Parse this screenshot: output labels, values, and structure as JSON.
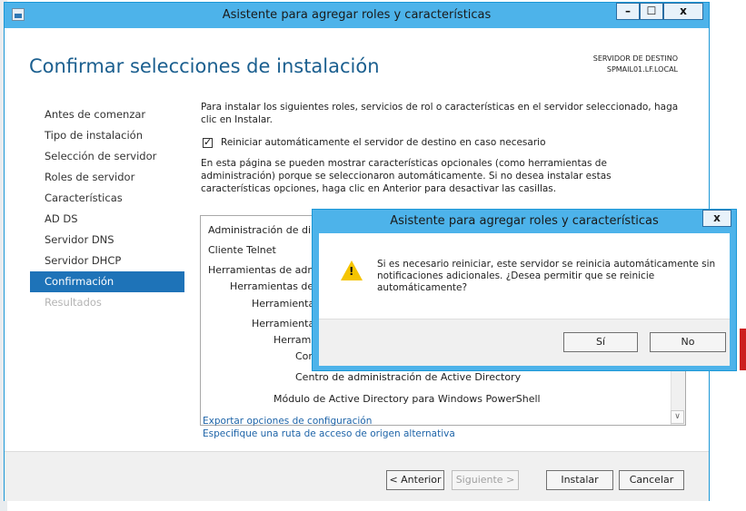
{
  "window": {
    "title": "Asistente para agregar roles y características",
    "minimize": "–",
    "maximize": "☐",
    "close": "x"
  },
  "page": {
    "title": "Confirmar selecciones de instalación",
    "destination_label": "SERVIDOR DE DESTINO",
    "destination_value": "SPMAIL01.LF.LOCAL"
  },
  "nav": {
    "items": [
      {
        "label": "Antes de comenzar",
        "state": "normal"
      },
      {
        "label": "Tipo de instalación",
        "state": "normal"
      },
      {
        "label": "Selección de servidor",
        "state": "normal"
      },
      {
        "label": "Roles de servidor",
        "state": "normal"
      },
      {
        "label": "Características",
        "state": "normal"
      },
      {
        "label": "AD DS",
        "state": "normal"
      },
      {
        "label": "Servidor DNS",
        "state": "normal"
      },
      {
        "label": "Servidor DHCP",
        "state": "normal"
      },
      {
        "label": "Confirmación",
        "state": "active"
      },
      {
        "label": "Resultados",
        "state": "disabled"
      }
    ]
  },
  "main": {
    "intro": "Para instalar los siguientes roles, servicios de rol o características en el servidor seleccionado, haga clic en Instalar.",
    "restart_checkbox_label": "Reiniciar automáticamente el servidor de destino en caso necesario",
    "restart_checked": true,
    "optional_text": "En esta página se pueden mostrar características opcionales (como herramientas de administración) porque se seleccionaron automáticamente. Si no desea instalar estas características opciones, haga clic en Anterior para desactivar las casillas.",
    "list": [
      "Administración de dire",
      "Cliente Telnet",
      "Herramientas de admin",
      "Herramientas de a",
      "Herramientas",
      "Herramientas",
      "Herramie",
      "Com",
      "Centro de administración de Active Directory",
      "Módulo de Active Directory para Windows PowerShell"
    ],
    "link_export": "Exportar opciones de configuración",
    "link_source": "Especifique una ruta de acceso de origen alternativa"
  },
  "footer": {
    "back": "< Anterior",
    "next": "Siguiente >",
    "install": "Instalar",
    "cancel": "Cancelar"
  },
  "dialog": {
    "title": "Asistente para agregar roles y características",
    "close": "x",
    "message": "Si es necesario reiniciar, este servidor se reinicia automáticamente sin notificaciones adicionales. ¿Desea permitir que se reinicie automáticamente?",
    "yes": "Sí",
    "no": "No"
  },
  "colors": {
    "titlebar": "#4db3ea",
    "accent": "#1e73b8",
    "heading": "#1b5f8f",
    "link": "#1e64a8",
    "warning": "#f5c400"
  }
}
